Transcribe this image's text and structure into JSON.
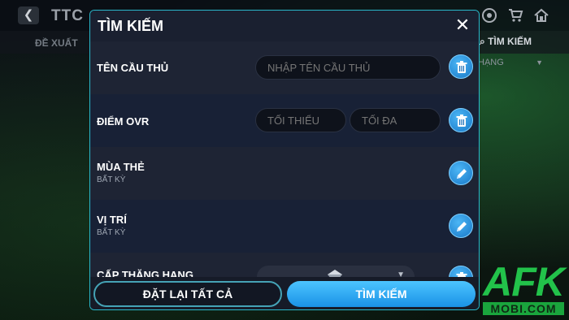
{
  "background": {
    "title": "TTC",
    "tab_left": "ĐỀ XUẤT",
    "tab_right": "TÌM KIẾM",
    "sort_label": "HẠNG",
    "icons": [
      "back-arrow-icon",
      "ball-icon",
      "cart-icon",
      "home-icon",
      "search-icon"
    ]
  },
  "modal": {
    "title": "TÌM KIẾM",
    "rows": [
      {
        "label": "TÊN CẦU THỦ",
        "input_placeholder": "NHẬP TÊN CẦU THỦ",
        "action_icon": "trash-icon"
      },
      {
        "label": "ĐIỂM OVR",
        "min_placeholder": "TỐI THIỂU",
        "max_placeholder": "TỐI ĐA",
        "action_icon": "trash-icon"
      },
      {
        "label": "MÙA THẺ",
        "sub": "BẤT KỲ",
        "action_icon": "pencil-icon"
      },
      {
        "label": "VỊ TRÍ",
        "sub": "BẤT KỲ",
        "action_icon": "pencil-icon"
      },
      {
        "label": "CẤP THĂNG HẠNG",
        "action_icon": "trash-icon"
      }
    ],
    "reset_button": "ĐẶT LẠI TẤT CẢ",
    "search_button": "TÌM KIẾM"
  },
  "watermark": {
    "main": "AFK",
    "sub": "MOBI.COM"
  },
  "colors": {
    "accent": "#1a92e6",
    "border": "#2ab7ca",
    "watermark": "#22c24a"
  }
}
